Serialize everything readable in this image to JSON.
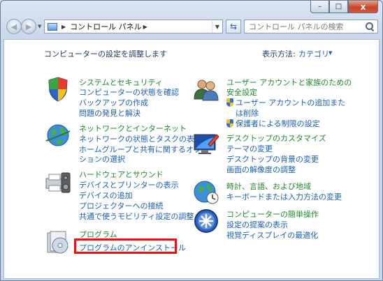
{
  "window": {
    "caption_buttons": {
      "minimize": "–",
      "maximize": "□",
      "close": "x"
    }
  },
  "nav": {
    "address_path": "コントロール パネル",
    "search_placeholder": "コントロール パネルの検索"
  },
  "header": {
    "title": "コンピューターの設定を調整します",
    "view_by_label": "表示方法:",
    "view_by_value": "カテゴリ"
  },
  "categories": {
    "system": {
      "title": "システムとセキュリティ",
      "links": [
        "コンピューターの状態を確認",
        "バックアップの作成",
        "問題の発見と解決"
      ],
      "icon": "shield-flag-icon"
    },
    "network": {
      "title": "ネットワークとインターネット",
      "links": [
        "ネットワークの状態とタスクの表示",
        "ホームグループと共有に関するオプ",
        "ションの選択"
      ],
      "icon": "globe-network-icon"
    },
    "hardware": {
      "title": "ハードウェアとサウンド",
      "links": [
        "デバイスとプリンターの表示",
        "デバイスの追加",
        "プロジェクターへの接続",
        "共通で使うモビリティ設定の調整"
      ],
      "icon": "printer-speaker-icon"
    },
    "programs": {
      "title": "プログラム",
      "links": [
        "プログラムのアンインストール"
      ],
      "icon": "programs-disc-icon"
    },
    "users": {
      "title_line1": "ユーザー アカウントと家族のための",
      "title_line2": "安全設定",
      "links": [
        "ユーザー アカウントの追加また",
        "は削除",
        "保護者による制限の設定"
      ],
      "icon": "users-icon"
    },
    "appearance": {
      "title": "デスクトップのカスタマイズ",
      "links": [
        "テーマの変更",
        "デスクトップの背景の変更",
        "画面の解像度の調整"
      ],
      "icon": "monitor-paint-icon"
    },
    "clock": {
      "title": "時計、言語、および地域",
      "links": [
        "キーボードまたは入力方法の変更"
      ],
      "icon": "globe-clock-icon"
    },
    "ease": {
      "title": "コンピューターの簡単操作",
      "links": [
        "設定の提案の表示",
        "視覚ディスプレイの最適化"
      ],
      "icon": "ease-of-access-icon"
    }
  },
  "colors": {
    "title_green": "#1c8a2a",
    "link_blue": "#1a5fb4",
    "highlight_red": "#ee1111"
  }
}
